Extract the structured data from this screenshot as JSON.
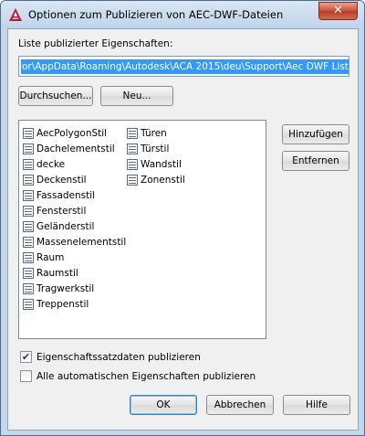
{
  "window": {
    "title": "Optionen zum Publizieren von AEC-DWF-Dateien",
    "close_glyph": "✕"
  },
  "path_section": {
    "label": "Liste publizierter Eigenschaften:",
    "value": "or\\AppData\\Roaming\\Autodesk\\ACA 2015\\deu\\Support\\Aec DWF List.ppl"
  },
  "buttons": {
    "browse": "Durchsuchen...",
    "new": "Neu...",
    "add": "Hinzufügen",
    "remove": "Entfernen",
    "ok": "OK",
    "cancel": "Abbrechen",
    "help": "Hilfe"
  },
  "list": {
    "icon": "property-list-icon",
    "column1": [
      "AecPolygonStil",
      "Dachelementstil",
      "decke",
      "Deckenstil",
      "Fassadenstil",
      "Fensterstil",
      "Geländerstil",
      "Massenelementstil",
      "Raum",
      "Raumstil",
      "Tragwerkstil",
      "Treppenstil"
    ],
    "column2": [
      "Türen",
      "Türstil",
      "Wandstil",
      "Zonenstil"
    ]
  },
  "options": {
    "publish_property_sets": {
      "label": "Eigenschaftssatzdaten publizieren",
      "checked": true
    },
    "publish_all_auto": {
      "label": "Alle automatischen Eigenschaften publizieren",
      "checked": false
    }
  },
  "colors": {
    "selection": "#3399ff",
    "frame": "#c3d6ea",
    "close_button": "#c74f3a"
  }
}
